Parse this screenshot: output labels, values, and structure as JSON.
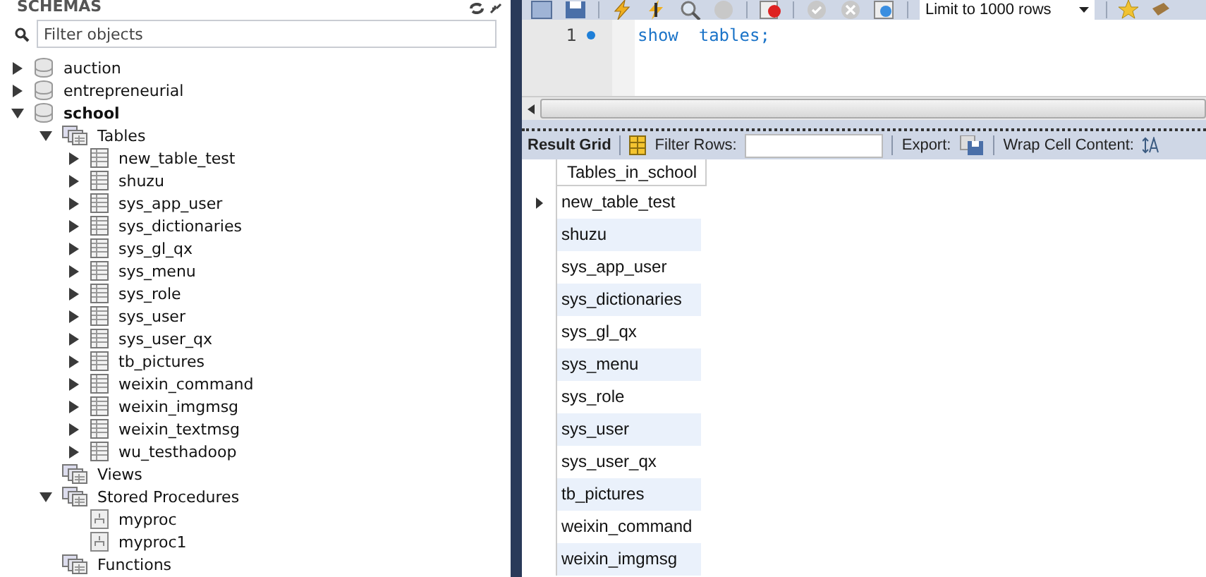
{
  "schemas_panel": {
    "title": "SCHEMAS",
    "filter": {
      "placeholder": "Filter objects"
    },
    "tree": [
      {
        "label": "auction",
        "kind": "schema",
        "active": false,
        "expandable": true,
        "expanded": false
      },
      {
        "label": "entrepreneurial",
        "kind": "schema",
        "active": false,
        "expandable": true,
        "expanded": false
      },
      {
        "label": "school",
        "kind": "schema",
        "active": true,
        "expandable": true,
        "expanded": true,
        "children": [
          {
            "label": "Tables",
            "kind": "folder",
            "expandable": true,
            "expanded": true,
            "children": [
              {
                "label": "new_table_test",
                "kind": "table",
                "expandable": true,
                "expanded": false
              },
              {
                "label": "shuzu",
                "kind": "table",
                "expandable": true,
                "expanded": false
              },
              {
                "label": "sys_app_user",
                "kind": "table",
                "expandable": true,
                "expanded": false
              },
              {
                "label": "sys_dictionaries",
                "kind": "table",
                "expandable": true,
                "expanded": false
              },
              {
                "label": "sys_gl_qx",
                "kind": "table",
                "expandable": true,
                "expanded": false
              },
              {
                "label": "sys_menu",
                "kind": "table",
                "expandable": true,
                "expanded": false
              },
              {
                "label": "sys_role",
                "kind": "table",
                "expandable": true,
                "expanded": false
              },
              {
                "label": "sys_user",
                "kind": "table",
                "expandable": true,
                "expanded": false
              },
              {
                "label": "sys_user_qx",
                "kind": "table",
                "expandable": true,
                "expanded": false
              },
              {
                "label": "tb_pictures",
                "kind": "table",
                "expandable": true,
                "expanded": false
              },
              {
                "label": "weixin_command",
                "kind": "table",
                "expandable": true,
                "expanded": false
              },
              {
                "label": "weixin_imgmsg",
                "kind": "table",
                "expandable": true,
                "expanded": false
              },
              {
                "label": "weixin_textmsg",
                "kind": "table",
                "expandable": true,
                "expanded": false
              },
              {
                "label": "wu_testhadoop",
                "kind": "table",
                "expandable": true,
                "expanded": false
              }
            ]
          },
          {
            "label": "Views",
            "kind": "folder",
            "expandable": false
          },
          {
            "label": "Stored Procedures",
            "kind": "folder",
            "expandable": true,
            "expanded": true,
            "children": [
              {
                "label": "myproc",
                "kind": "routine",
                "expandable": false
              },
              {
                "label": "myproc1",
                "kind": "routine",
                "expandable": false
              }
            ]
          },
          {
            "label": "Functions",
            "kind": "folder",
            "expandable": false
          }
        ]
      }
    ]
  },
  "query_toolbar": {
    "limit": "Limit to 1000 rows"
  },
  "editor": {
    "lines": [
      {
        "number": "1",
        "code": "show  tables;"
      }
    ]
  },
  "result_toolbar": {
    "result_grid": "Result Grid",
    "filter_label": "Filter Rows:",
    "export_label": "Export:",
    "wrap_label": "Wrap Cell Content:"
  },
  "grid": {
    "columns": [
      "Tables_in_school"
    ],
    "rows": [
      {
        "value": "new_table_test",
        "current": true
      },
      {
        "value": "shuzu",
        "current": false
      },
      {
        "value": "sys_app_user",
        "current": false
      },
      {
        "value": "sys_dictionaries",
        "current": false
      },
      {
        "value": "sys_gl_qx",
        "current": false
      },
      {
        "value": "sys_menu",
        "current": false
      },
      {
        "value": "sys_role",
        "current": false
      },
      {
        "value": "sys_user",
        "current": false
      },
      {
        "value": "sys_user_qx",
        "current": false
      },
      {
        "value": "tb_pictures",
        "current": false
      },
      {
        "value": "weixin_command",
        "current": false
      },
      {
        "value": "weixin_imgmsg",
        "current": false
      }
    ]
  }
}
